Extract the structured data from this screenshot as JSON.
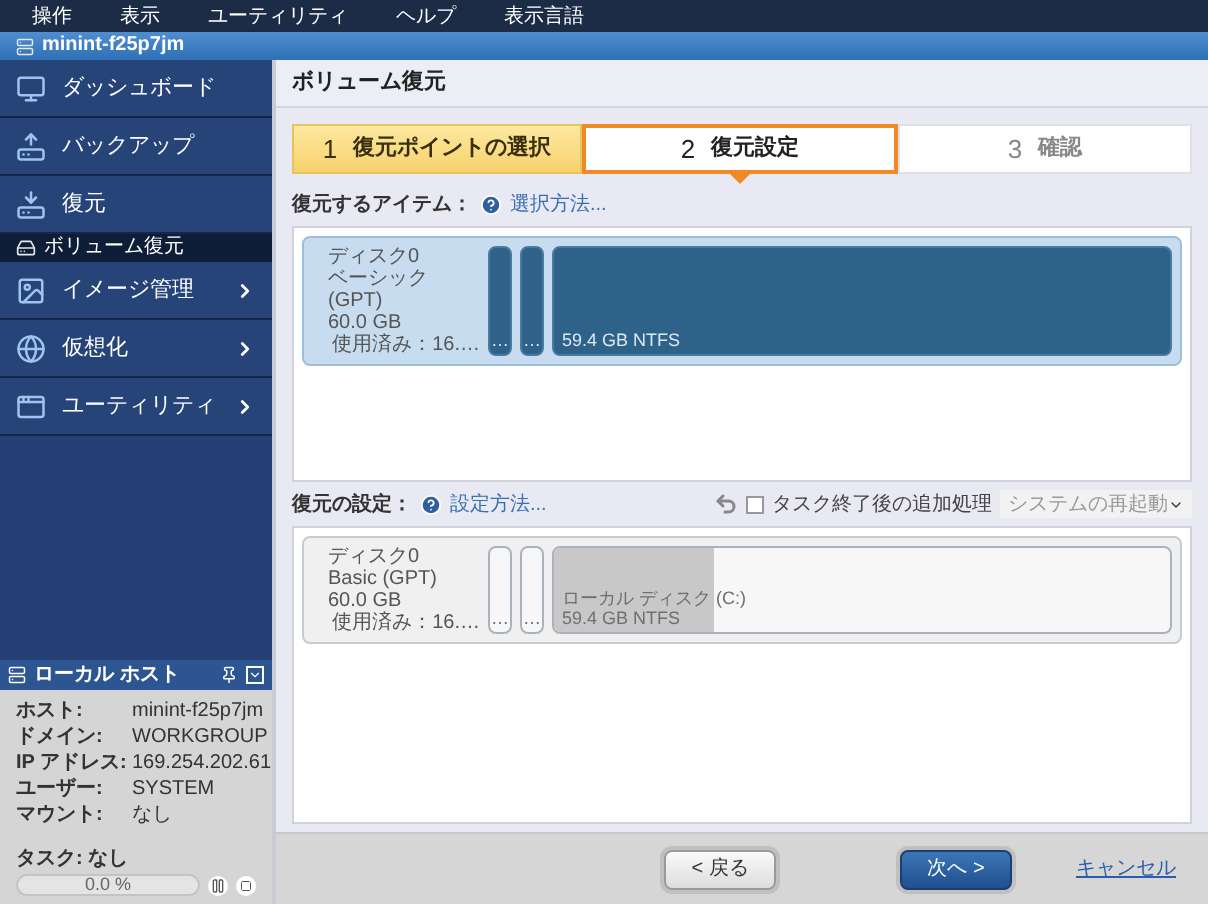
{
  "menu_bar": [
    "操作",
    "表示",
    "ユーティリティ",
    "ヘルプ",
    "表示言語"
  ],
  "window": {
    "title": "minint-f25p7jm"
  },
  "sidebar": {
    "items": [
      {
        "label": "ダッシュボード",
        "kind": "main",
        "selected": false,
        "expandable": false
      },
      {
        "label": "バックアップ",
        "kind": "main",
        "selected": false,
        "expandable": false
      },
      {
        "label": "復元",
        "kind": "main",
        "selected": false,
        "expandable": false
      },
      {
        "label": "ボリューム復元",
        "kind": "sub",
        "selected": true
      },
      {
        "label": "イメージ管理",
        "kind": "main",
        "selected": false,
        "expandable": true
      },
      {
        "label": "仮想化",
        "kind": "main",
        "selected": false,
        "expandable": true
      },
      {
        "label": "ユーティリティ",
        "kind": "main",
        "selected": false,
        "expandable": true
      }
    ]
  },
  "local_host": {
    "title": "ローカル ホスト",
    "fields": [
      {
        "label": "ホスト:",
        "value": "minint-f25p7jm"
      },
      {
        "label": "ドメイン:",
        "value": "WORKGROUP"
      },
      {
        "label": "IP アドレス:",
        "value": "169.254.202.61"
      },
      {
        "label": "ユーザー:",
        "value": "SYSTEM"
      },
      {
        "label": "マウント:",
        "value": "なし"
      }
    ],
    "task": "タスク: なし",
    "progress": {
      "level": 0,
      "reading": "0.0 %"
    }
  },
  "main": {
    "title": "ボリューム復元",
    "steps": [
      {
        "number": "1",
        "label": "復元ポイントの選択",
        "selected": false,
        "completed": true
      },
      {
        "number": "2",
        "label": "復元設定",
        "selected": true
      },
      {
        "number": "3",
        "label": "確認",
        "selected": false,
        "completed": false
      }
    ],
    "items_section": {
      "label": "復元するアイテム：",
      "help_link": "選択方法...",
      "disk": {
        "selected": true,
        "lines": [
          "ディスク0",
          "ベーシック (GPT)",
          "60.0 GB"
        ],
        "usage": "使用済み：16.…",
        "partitions": [
          {
            "kind": "small",
            "lines": [
              "…"
            ]
          },
          {
            "kind": "small",
            "lines": [
              "…"
            ]
          },
          {
            "kind": "large",
            "lines": [
              "59.4 GB NTFS"
            ]
          }
        ]
      }
    },
    "settings_section": {
      "label": "復元の設定：",
      "help_link": "設定方法...",
      "post_task": {
        "label": "タスク終了後の追加処理",
        "checked": false,
        "value": "システムの再起動"
      },
      "disk": {
        "selected": false,
        "lines": [
          "ディスク0",
          "Basic (GPT)",
          "60.0 GB"
        ],
        "usage": "使用済み：16.…",
        "partitions": [
          {
            "kind": "small",
            "lines": [
              "…"
            ]
          },
          {
            "kind": "small",
            "lines": [
              "…"
            ]
          },
          {
            "kind": "large",
            "lines": [
              "ローカル ディスク (C:)",
              "59.4 GB NTFS"
            ],
            "level": 0.26
          }
        ]
      }
    },
    "buttons": {
      "back": "< 戻る",
      "next": "次へ >",
      "cancel": "キャンセル"
    }
  }
}
